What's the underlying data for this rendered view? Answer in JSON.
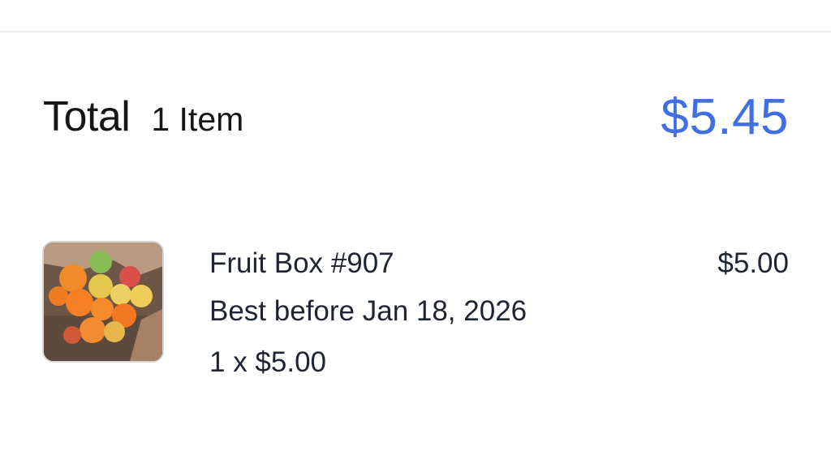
{
  "summary": {
    "total_label": "Total",
    "item_count": "1 Item",
    "total_amount": "$5.45"
  },
  "line_items": [
    {
      "thumbnail_icon": "fruit-box-photo",
      "name": "Fruit Box #907",
      "best_before": "Best before Jan 18, 2026",
      "quantity_price": "1 x $5.00",
      "line_total": "$5.00"
    }
  ],
  "colors": {
    "accent": "#3f6fe3",
    "text_primary": "#161616",
    "text_secondary": "#1f2433",
    "divider": "#ececec"
  }
}
